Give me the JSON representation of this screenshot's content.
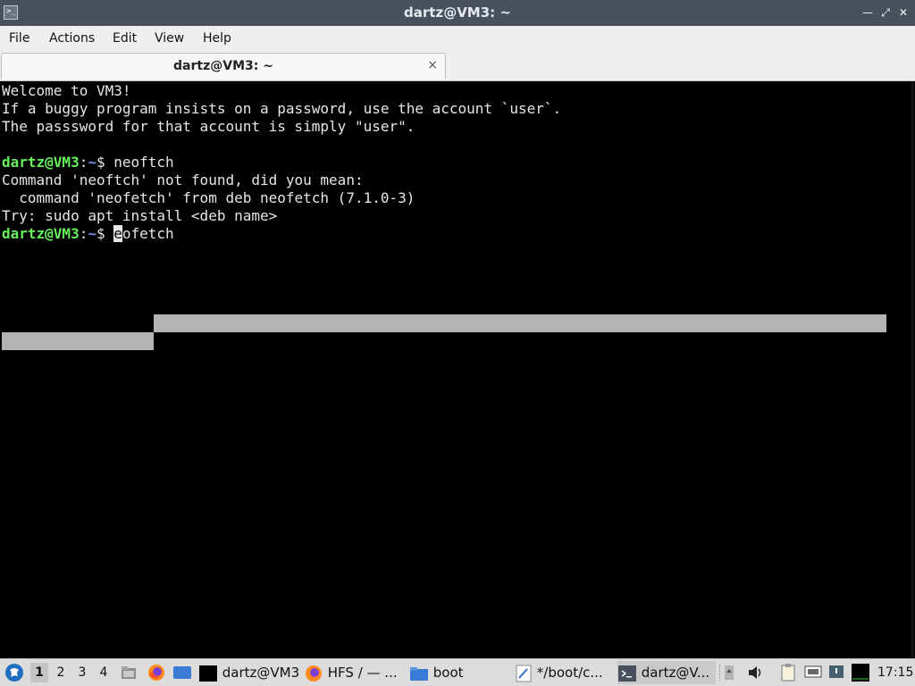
{
  "window": {
    "title": "dartz@VM3: ~"
  },
  "menu": {
    "items": [
      "File",
      "Actions",
      "Edit",
      "View",
      "Help"
    ]
  },
  "tab": {
    "label": "dartz@VM3: ~",
    "close": "×"
  },
  "terminal": {
    "lines": [
      "Welcome to VM3!",
      "If a buggy program insists on a password, use the account `user`.",
      "The passsword for that account is simply \"user\"."
    ],
    "prompt1": {
      "user": "dartz@VM3",
      "sep": ":",
      "path": "~",
      "sign": "$ ",
      "cmd": "neoftch"
    },
    "output": [
      "Command 'neoftch' not found, did you mean:",
      "  command 'neofetch' from deb neofetch (7.1.0-3)",
      "Try: sudo apt install <deb name>"
    ],
    "prompt2": {
      "user": "dartz@VM3",
      "sep": ":",
      "path": "~",
      "sign": "$ ",
      "cursor_char": "e",
      "cmd_rest": "ofetch"
    }
  },
  "taskbar": {
    "workspaces": [
      "1",
      "2",
      "3",
      "4"
    ],
    "active_workspace": "1",
    "tasks": [
      {
        "label": "dartz@VM3"
      },
      {
        "label": "HFS / — ..."
      },
      {
        "label": "boot"
      },
      {
        "label": "*/boot/c..."
      },
      {
        "label": "dartz@V..."
      }
    ],
    "clock": "17:15"
  }
}
